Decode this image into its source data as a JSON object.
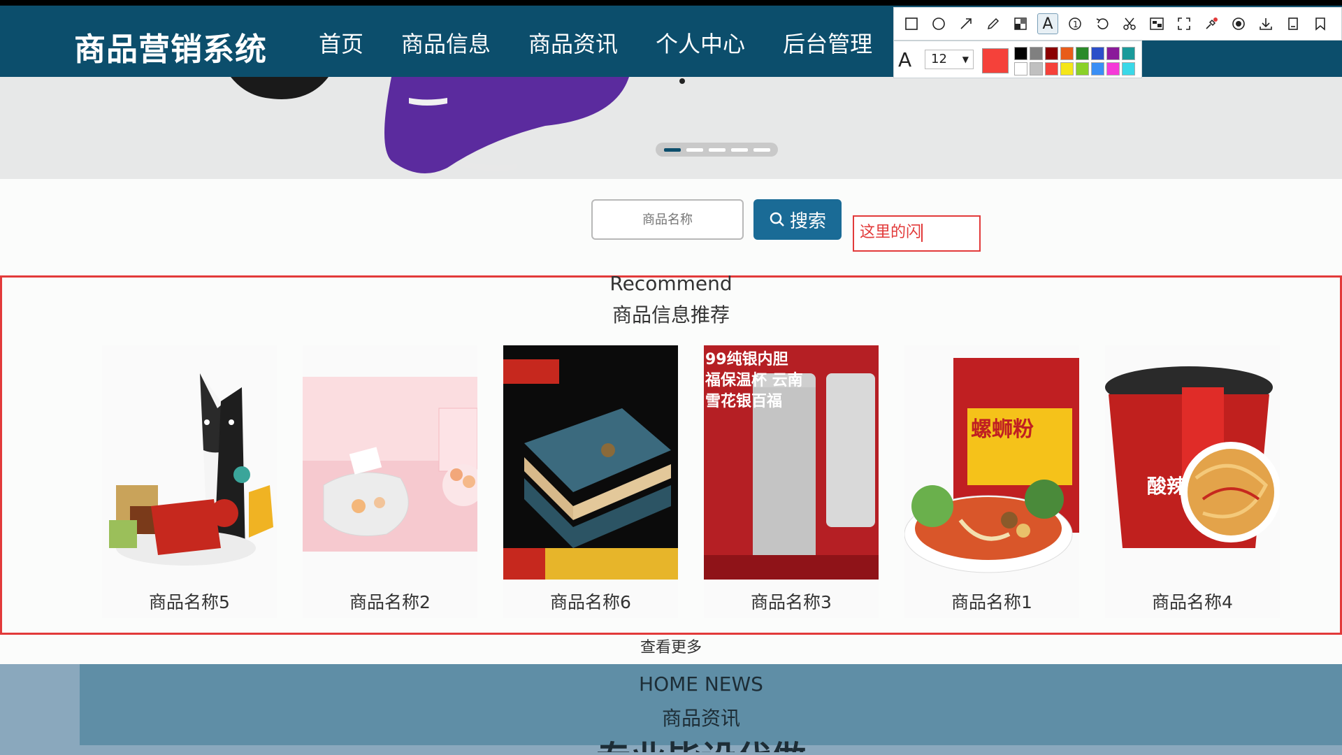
{
  "header": {
    "logo": "商品营销系统",
    "nav": [
      "首页",
      "商品信息",
      "商品资讯",
      "个人中心",
      "后台管理"
    ]
  },
  "banner": {
    "active_slide": 1,
    "slide_count": 5
  },
  "search": {
    "placeholder": "商品名称",
    "button_label": "搜索"
  },
  "annotation": {
    "text": "这里的闪"
  },
  "recommend": {
    "title_en": "Recommend",
    "title_cn": "商品信息推荐",
    "products": [
      {
        "name": "商品名称5"
      },
      {
        "name": "商品名称2"
      },
      {
        "name": "商品名称6"
      },
      {
        "name": "商品名称3",
        "image_text": "99纯银内胆 福保温杯 云南雪花银百福"
      },
      {
        "name": "商品名称1",
        "image_text": "螺蛳粉"
      },
      {
        "name": "商品名称4",
        "image_text": "酸辣"
      }
    ],
    "see_more": "查看更多"
  },
  "news": {
    "title_en": "HOME NEWS",
    "title_cn": "商品资讯",
    "headline": "专业毕设代做"
  },
  "toolbar": {
    "tools": [
      "rectangle-icon",
      "ellipse-icon",
      "arrow-icon",
      "pencil-icon",
      "mosaic-icon",
      "text-icon",
      "number-icon",
      "undo-icon",
      "cut-icon",
      "ocr-icon",
      "fullscreen-icon",
      "pin-icon",
      "record-icon",
      "download-icon",
      "save-icon",
      "bookmark-icon"
    ],
    "active_tool": "text-icon",
    "font_size": "12",
    "current_color": "#f5413a",
    "palette": [
      "#000000",
      "#808080",
      "#8b0000",
      "#e85c1a",
      "#2a8a2a",
      "#2b4fc9",
      "#8a1a9a",
      "#1a9a9a",
      "#ffffff",
      "#c0c0c0",
      "#f5413a",
      "#f5e61a",
      "#8ad12a",
      "#3a8ff5",
      "#f53ad8",
      "#3ad8e8"
    ]
  }
}
